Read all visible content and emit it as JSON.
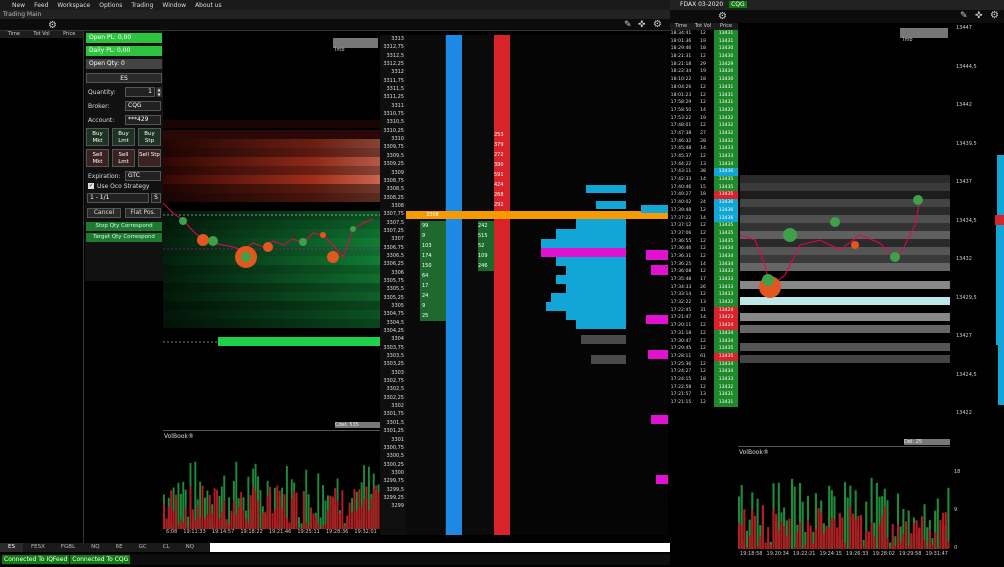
{
  "menu": [
    "New",
    "Feed",
    "Workspace",
    "Options",
    "Trading",
    "Window",
    "About us"
  ],
  "left_window": {
    "title": "Trading Main"
  },
  "right_window": {
    "title": "FDAX 03-2020",
    "badge": "CQG"
  },
  "ts_headers": {
    "time": "Time",
    "tot_vol": "Tot Vol",
    "price": "Price"
  },
  "order_panel": {
    "open_pl": "Open PL: 0,00",
    "daily_pl": "Daily PL: 0,00",
    "open_qty": "Open Qty: 0",
    "symbol": "ES",
    "quantity_label": "Quantity:",
    "quantity_value": "1",
    "broker_label": "Broker:",
    "broker_value": "CQG",
    "account_label": "Account:",
    "account_value": "***429",
    "buy_mkt": "Buy Mkt",
    "buy_lmt": "Buy Lmt",
    "buy_stp": "Buy Stp",
    "sell_mkt": "Sell Mkt",
    "sell_lmt": "Sell Lmt",
    "sell_stp": "Sell Stp",
    "expiration_label": "Expiration:",
    "expiration_value": "GTC",
    "oco_label": "Use Oco Strategy",
    "oco_value": "1 - 1/1",
    "oco_s": "S",
    "cancel": "Cancel",
    "flat_pos": "Flat Pos.",
    "stop_qty": "Stop Qty Correspond",
    "target_qty": "Target Qty Correspond"
  },
  "imb_label": "Imb",
  "cdel_left": "Cdel: 535",
  "cdel_right": "Del: 25",
  "volbook_label": "VolBook®",
  "price_ladder": [
    "3313",
    "3312,75",
    "3312,5",
    "3312,25",
    "3312",
    "3311,75",
    "3311,5",
    "3311,25",
    "3311",
    "3310,75",
    "3310,5",
    "3310,25",
    "3310",
    "3309,75",
    "3309,5",
    "3309,25",
    "3309",
    "3308,75",
    "3308,5",
    "3308,25",
    "3308",
    "3307,75",
    "3307,5",
    "3307,25",
    "3307",
    "3306,75",
    "3306,5",
    "3306,25",
    "3306",
    "3305,75",
    "3305,5",
    "3305,25",
    "3305",
    "3304,75",
    "3304,5",
    "3304,25",
    "3304",
    "3303,75",
    "3303,5",
    "3303,25",
    "3303",
    "3302,75",
    "3302,5",
    "3302,25",
    "3302",
    "3301,75",
    "3301,5",
    "3301,25",
    "3301",
    "3300,75",
    "3300,5",
    "3300,25",
    "3300",
    "3299,75",
    "3299,5",
    "3299,25",
    "3299"
  ],
  "dom_ask_vols": [
    "253",
    "379",
    "272",
    "390",
    "591",
    "424",
    "268",
    "292"
  ],
  "dom_bid_vols": [
    "99",
    "9",
    "103",
    "174",
    "150",
    "64",
    "17",
    "24",
    "9",
    "25"
  ],
  "dom_bid_trades": [
    "242",
    "515",
    "52",
    "109",
    "246"
  ],
  "current_price": "3308",
  "time_axis_left": [
    "6:08",
    "19:11:33",
    "19:14:57",
    "19:18:22",
    "19:21:46",
    "19:25:11",
    "19:28:36",
    "19:32:01"
  ],
  "time_axis_right": [
    "19:18:58",
    "19:20:34",
    "19:22:21",
    "19:24:15",
    "19:26:33",
    "19:28:02",
    "19:29:58",
    "19:31:47"
  ],
  "tabs": [
    "ES",
    "FESX",
    "FGBL",
    "NQ",
    "6E",
    "GC",
    "CL",
    "NQ"
  ],
  "status": [
    "Connected To IQFeed",
    "Connected To CQG"
  ],
  "ts_right_rows": [
    [
      "18:34:41",
      "12",
      "13431"
    ],
    [
      "18:01:36",
      "19",
      "13431"
    ],
    [
      "18:29:46",
      "18",
      "13430"
    ],
    [
      "18:21:31",
      "12",
      "13430"
    ],
    [
      "18:21:18",
      "29",
      "13429"
    ],
    [
      "18:22:34",
      "19",
      "13430"
    ],
    [
      "18:10:22",
      "18",
      "13430"
    ],
    [
      "18:04:26",
      "12",
      "13431"
    ],
    [
      "18:01:23",
      "12",
      "13431"
    ],
    [
      "17:58:29",
      "12",
      "13431"
    ],
    [
      "17:58:50",
      "14",
      "13432"
    ],
    [
      "17:53:22",
      "19",
      "13432"
    ],
    [
      "17:48:01",
      "12",
      "13432"
    ],
    [
      "17:47:38",
      "27",
      "13432"
    ],
    [
      "17:46:32",
      "28",
      "13432"
    ],
    [
      "17:45:48",
      "14",
      "13433"
    ],
    [
      "17:45:37",
      "12",
      "13433"
    ],
    [
      "17:44:22",
      "13",
      "13434"
    ],
    [
      "17:43:11",
      "38",
      "13436"
    ],
    [
      "17:42:33",
      "14",
      "13435"
    ],
    [
      "17:40:46",
      "15",
      "13435"
    ],
    [
      "17:40:27",
      "18",
      "13435"
    ],
    [
      "17:40:02",
      "24",
      "13436"
    ],
    [
      "17:39:48",
      "12",
      "13436"
    ],
    [
      "17:37:22",
      "14",
      "13436"
    ],
    [
      "17:37:12",
      "12",
      "13435"
    ],
    [
      "17:37:06",
      "12",
      "13435"
    ],
    [
      "17:36:55",
      "12",
      "13435"
    ],
    [
      "17:36:46",
      "12",
      "13434"
    ],
    [
      "17:36:31",
      "12",
      "13434"
    ],
    [
      "17:36:25",
      "14",
      "13434"
    ],
    [
      "17:36:08",
      "12",
      "13433"
    ],
    [
      "17:35:48",
      "17",
      "13433"
    ],
    [
      "17:34:33",
      "26",
      "13433"
    ],
    [
      "17:33:14",
      "12",
      "13433"
    ],
    [
      "17:32:22",
      "13",
      "13432"
    ],
    [
      "17:22:45",
      "31",
      "13424"
    ],
    [
      "17:21:47",
      "14",
      "13423"
    ],
    [
      "17:20:11",
      "12",
      "13424"
    ],
    [
      "17:31:18",
      "12",
      "13434"
    ],
    [
      "17:30:47",
      "12",
      "13434"
    ],
    [
      "17:29:45",
      "12",
      "13435"
    ],
    [
      "17:28:11",
      "61",
      "13435"
    ],
    [
      "17:25:36",
      "12",
      "13434"
    ],
    [
      "17:24:27",
      "12",
      "13434"
    ],
    [
      "17:24:15",
      "18",
      "13433"
    ],
    [
      "17:22:58",
      "12",
      "13432"
    ],
    [
      "17:21:57",
      "13",
      "13431"
    ],
    [
      "17:21:15",
      "12",
      "13431"
    ]
  ],
  "right_price_axis": [
    "13447",
    "13444,5",
    "13442",
    "13439,5",
    "13437",
    "13434,5",
    "13432",
    "13429,5",
    "13427",
    "13424,5",
    "13422"
  ],
  "right_volbook_axis": [
    "18",
    "9",
    "0"
  ],
  "colors": {
    "ask": "#d9232a",
    "bid": "#1e8a3a",
    "accent_blue": "#1e88e5",
    "current": "#f59b00",
    "cyan": "#12a6d6",
    "magenta": "#e012d0"
  }
}
